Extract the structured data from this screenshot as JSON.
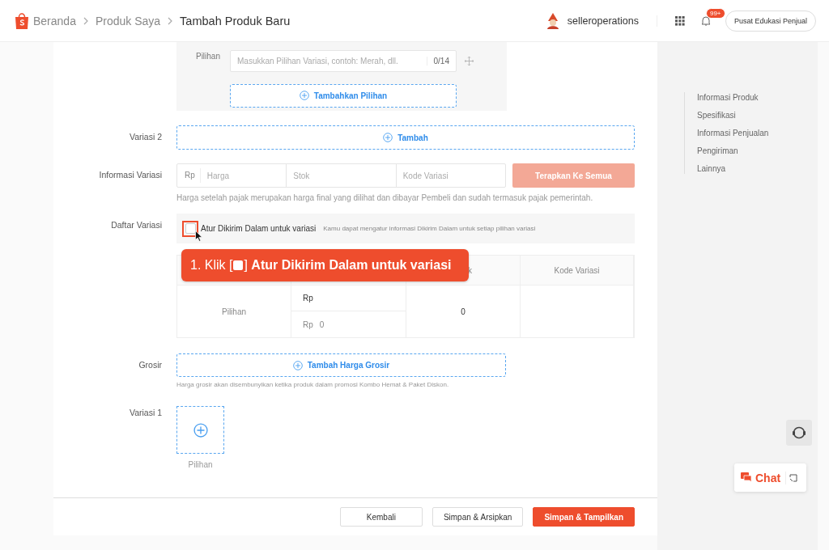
{
  "breadcrumb": [
    "Beranda",
    "Produk Saya",
    "Tambah Produk Baru"
  ],
  "header": {
    "username": "selleroperations",
    "notification_badge": "99+",
    "education_button": "Pusat Edukasi Penjual"
  },
  "option_editor": {
    "label": "Pilihan",
    "placeholder": "Masukkan Pilihan Variasi, contoh: Merah, dll.",
    "counter": "0/14",
    "add_button": "Tambahkan Pilihan"
  },
  "variation2": {
    "label": "Variasi 2",
    "add_button": "Tambah"
  },
  "variation_info": {
    "label": "Informasi Variasi",
    "currency": "Rp",
    "price_placeholder": "Harga",
    "stock_placeholder": "Stok",
    "code_placeholder": "Kode Variasi",
    "apply_button": "Terapkan Ke Semua",
    "apply_disabled": true,
    "note": "Harga setelah pajak merupakan harga final yang dilihat dan dibayar Pembeli dan sudah termasuk pajak pemerintah."
  },
  "variation_list": {
    "label": "Daftar Variasi",
    "checkbox": {
      "label": "Atur Dikirim Dalam untuk variasi",
      "checked": false,
      "highlighted": true,
      "hint": "Kamu dapat mengatur informasi Dikirim Dalam untuk setiap pilihan variasi"
    },
    "table": {
      "column_3": "k",
      "column_4": "Kode Variasi",
      "rows": [
        {
          "option": "Pilihan",
          "price_top": "Rp",
          "price_currency": "Rp",
          "price_value": "0",
          "stock": "0"
        }
      ]
    }
  },
  "callout": {
    "prefix": "1. Klik [",
    "suffix": "] **Atur Dikirim Dalam untuk variasi**"
  },
  "wholesale": {
    "label": "Grosir",
    "add_button": "Tambah Harga Grosir",
    "note": "Harga grosir akan disembunyikan ketika produk dalam promosi Kombo Hemat & Paket Diskon."
  },
  "variation1": {
    "label": "Variasi 1",
    "caption": "Pilihan"
  },
  "side_nav": [
    "Informasi Produk",
    "Spesifikasi",
    "Informasi Penjualan",
    "Pengiriman",
    "Lainnya"
  ],
  "chat": {
    "label": "Chat"
  },
  "footer_buttons": [
    {
      "label": "Kembali",
      "kind": "secondary"
    },
    {
      "label": "Simpan & Arsipkan",
      "kind": "secondary"
    },
    {
      "label": "Simpan & Tampilkan",
      "kind": "primary"
    }
  ]
}
